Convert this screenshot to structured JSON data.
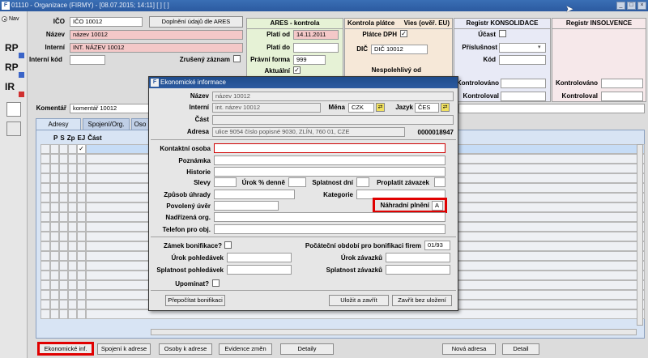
{
  "window": {
    "title": "01110 - Organizace (FIRMY) - [08.07.2015; 14:11] [ ] [ ]",
    "controls": [
      "_",
      "□",
      "×"
    ]
  },
  "nav": {
    "label": "Nav",
    "icons": [
      "RP",
      "RP",
      "IR"
    ]
  },
  "org": {
    "ico_label": "IČO",
    "ico_value": "IČO 10012",
    "nazev_label": "Název",
    "nazev_value": "název 10012",
    "interni_label": "Interní",
    "interni_value": "INT. NÁZEV 10012",
    "interni_kod_label": "Interní kód",
    "interni_kod_value": "",
    "zruseny_label": "Zrušený záznam",
    "doplneni_button": "Doplnění údajů dle ARES",
    "komentar_label": "Komentář",
    "komentar_value": "komentář 10012"
  },
  "ares": {
    "header": "ARES - kontrola",
    "plati_od_label": "Platí od",
    "plati_od_value": "14.11.2011",
    "plati_do_label": "Platí do",
    "plati_do_value": "",
    "pravni_forma_label": "Právní forma",
    "pravni_forma_value": "999",
    "aktualni_label": "Aktuální"
  },
  "platce": {
    "header": "Kontrola plátce",
    "vies_header": "Vies (ověř. EU)",
    "platce_dph_label": "Plátce DPH",
    "dic_label": "DIČ",
    "dic_value": "DIČ 10012",
    "nespolehlivy_label": "Nespolehlivý od"
  },
  "konsolidace": {
    "header": "Registr KONSOLIDACE",
    "ucast_label": "Účast",
    "prislusnost_label": "Příslušnost",
    "kod_label": "Kód",
    "kontrolovano_label": "Kontrolováno",
    "kontroloval_label": "Kontroloval"
  },
  "insolvence": {
    "header": "Registr INSOLVENCE",
    "kontrolovano_label": "Kontrolováno",
    "kontroloval_label": "Kontroloval"
  },
  "tabs": [
    {
      "label": "Adresy"
    },
    {
      "label": "Spojení/Org."
    },
    {
      "label": "Oso"
    }
  ],
  "grid": {
    "columns": [
      "P",
      "S",
      "Zp",
      "EJ",
      "Část"
    ]
  },
  "bottom_buttons": {
    "ekonomicke": "Ekonomické inf.",
    "spojeni": "Spojení k adrese",
    "osoby": "Osoby k adrese",
    "evidence": "Evidence změn",
    "detaily": "Detaily",
    "nova_adresa": "Nová adresa",
    "detail": "Detail"
  },
  "dialog": {
    "title": "Ekonomické informace",
    "nazev_label": "Název",
    "nazev_value": "název 10012",
    "interni_label": "Interní",
    "interni_value": "int. název 10012",
    "mena_label": "Měna",
    "mena_value": "CZK",
    "jazyk_label": "Jazyk",
    "jazyk_value": "ČES",
    "cast_label": "Část",
    "cast_value": "",
    "adresa_label": "Adresa",
    "adresa_value": "ulice 9054 číslo popisné 9030, ZLÍN, 760 01, CZE",
    "adresa_code": "0000018947",
    "kontaktni_osoba_label": "Kontaktní osoba",
    "poznamka_label": "Poznámka",
    "historie_label": "Historie",
    "slevy_label": "Slevy",
    "urok_denne_label": "Úrok % denně",
    "splatnost_dni_label": "Splatnost dní",
    "proplatit_label": "Proplatit závazek",
    "zpusob_uhrady_label": "Způsob úhrady",
    "kategorie_label": "Kategorie",
    "povoleny_uver_label": "Povolený úvěr",
    "nahradni_plneni_label": "Náhradní plnění",
    "nahradni_plneni_value": "A",
    "nadrizena_label": "Nadřízená org.",
    "telefon_label": "Telefon pro obj.",
    "zamek_label": "Zámek bonifikace?",
    "pocatecni_label": "Počáteční období pro bonifikaci firem",
    "pocatecni_value": "01/93",
    "urok_pohledavek_label": "Úrok pohledávek",
    "urok_zavazku_label": "Úrok závazků",
    "splatnost_pohledavek_label": "Splatnost pohledávek",
    "splatnost_zavazku_label": "Splatnost závazků",
    "upominat_label": "Upomínat?",
    "prepocitat_button": "Přepočítat bonifikaci",
    "ulozit_button": "Uložit a zavřít",
    "zavrit_button": "Zavřít bez uložení"
  }
}
